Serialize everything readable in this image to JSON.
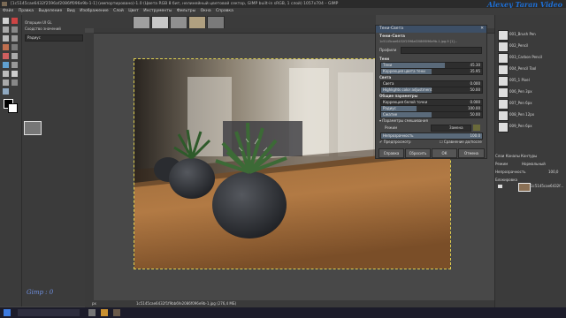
{
  "window": {
    "title": "[1c5145cae6432f2596af2086ff096e9b-1-1] (импортировано)-1.0 (Цвета RGB 8 бит, нелинейный цветовой сектор, GIMP built-in sRGB, 1 слой) 1057x704 – GIMP",
    "watermark": "Alexey Taran Video"
  },
  "menu": [
    "Файл",
    "Правка",
    "Выделение",
    "Вид",
    "Изображение",
    "Слой",
    "Цвет",
    "Инструменты",
    "Фильтры",
    "Окна",
    "Справка"
  ],
  "left_panel": {
    "title": "Опорции UI GL",
    "subtitle": "Сходство значений",
    "mode": "Радиус"
  },
  "status_overlay": "Gimp : 0",
  "statusbar": {
    "zoom": "px",
    "file": "1c5145cae6432f1f9bb6fe2086f096e9b-1.jpg (276,4 МБ)"
  },
  "brushes": [
    {
      "name": "001_Brush Pen"
    },
    {
      "name": "002_Pencil"
    },
    {
      "name": "003_Carbon Pencil"
    },
    {
      "name": "004_Pencil Tool"
    },
    {
      "name": "005_1 Pixel"
    },
    {
      "name": "006_Pen 3px"
    },
    {
      "name": "007_Pen 6px"
    },
    {
      "name": "008_Pen 12px"
    },
    {
      "name": "009_Pen 6px"
    }
  ],
  "layers_panel": {
    "tabs": [
      "Слои",
      "Каналы",
      "Контуры"
    ],
    "mode_label": "Режим",
    "mode_value": "Нормальный",
    "opacity_label": "Непрозрачность",
    "opacity_value": "100,0",
    "lock_label": "Блокировка",
    "layer_name": "1c5145cae6432f..."
  },
  "dialog": {
    "window_title": "Тени-Света",
    "heading": "Тени-Света",
    "sub": "1c5145cae6432f2596af2086f096e9b-1.jpg-9 [1]...",
    "presets_label": "Профили",
    "shadows_section": "Тени",
    "shadows_label": "Тени",
    "shadows_value": "45.30",
    "shadows_fraction": 0.63,
    "shadows_color_label": "Коррекция цвета тени",
    "shadows_color_value": "35.95",
    "shadows_color_fraction": 0.5,
    "highlights_section": "Света",
    "highlights_label": "Света",
    "highlights_value": "0.000",
    "highlights_fraction": 0.0,
    "highlights_color_label": "Highlights color adjustment",
    "highlights_color_value": "50.00",
    "highlights_color_fraction": 0.5,
    "common_section": "Общие параметры",
    "white_point_label": "Коррекция белой точки",
    "white_point_value": "0.000",
    "white_point_fraction": 0.0,
    "radius_label": "Радиус",
    "radius_value": "100.00",
    "radius_fraction": 0.35,
    "compress_label": "Сжатие",
    "compress_value": "50.00",
    "compress_fraction": 0.5,
    "blend_section": "Параметры смешивания",
    "mode_label": "Режим",
    "mode_value": "Замена",
    "opacity_label": "Непрозрачность",
    "opacity_value": "100.0",
    "opacity_fraction": 1.0,
    "preview_label": "Предпросмотр",
    "split_label": "Сравнение до/после",
    "btn_help": "Справка",
    "btn_reset": "Сбросить",
    "btn_ok": "ОК",
    "btn_cancel": "Отмена"
  },
  "colors": {
    "accent": "#3d4f66",
    "watermark": "#1d6fd6",
    "selection": "#e0d050"
  }
}
